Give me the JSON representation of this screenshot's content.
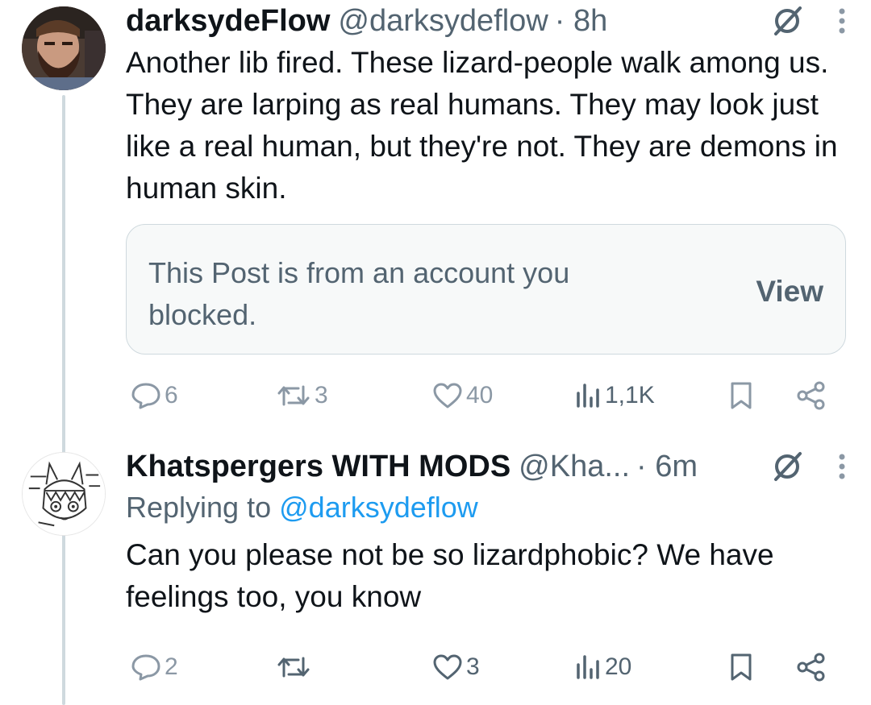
{
  "tweets": [
    {
      "display_name": "darksydeFlow",
      "handle": "@darksydeflow",
      "time": "· 8h",
      "text": "Another lib fired. These lizard-people walk among us. They are larping as real humans. They may look just like a real human, but they're not. They are demons in human skin.",
      "blocked_card": {
        "message": "This Post is from an account you blocked.",
        "action_label": "View"
      },
      "stats": {
        "replies": "6",
        "reposts": "3",
        "likes": "40",
        "views": "1,1K"
      }
    },
    {
      "display_name": "Khatspergers WITH MODS",
      "handle": "@Kha...",
      "time": "· 6m",
      "replying_prefix": "Replying to",
      "replying_to": "@darksydeflow",
      "text": "Can you please not be so lizardphobic? We have feelings too, you know",
      "stats": {
        "replies": "2",
        "reposts": "",
        "likes": "3",
        "views": "20"
      }
    }
  ],
  "icons": {
    "header": [
      "grok-icon",
      "more-options-icon"
    ],
    "actions": [
      "reply-icon",
      "repost-icon",
      "like-icon",
      "views-icon",
      "bookmark-icon",
      "share-icon"
    ]
  },
  "colors": {
    "text": "#0f1419",
    "secondary": "#536471",
    "link": "#1d9bf0",
    "border": "#cfd9de",
    "card_bg": "#f7f9f9"
  }
}
